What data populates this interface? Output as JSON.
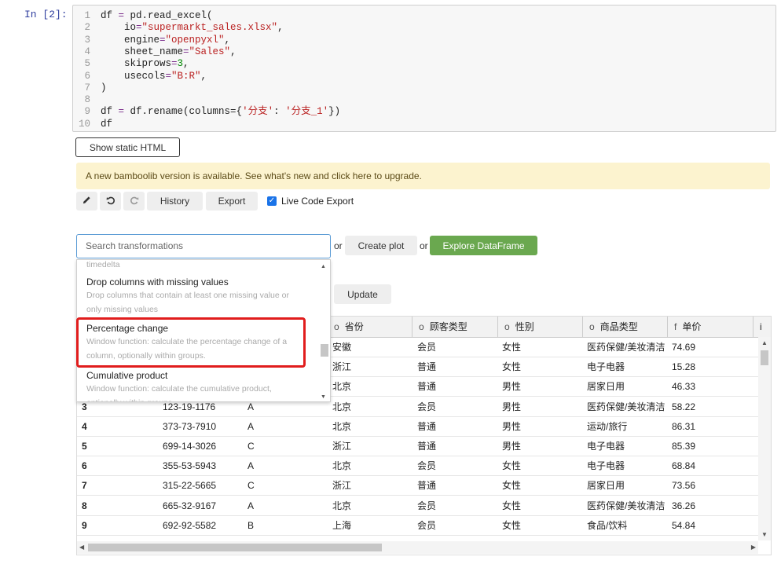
{
  "prompt": "In  [2]:",
  "code": {
    "lines": [
      {
        "n": "1",
        "parts": [
          {
            "t": "df ",
            "c": ""
          },
          {
            "t": "=",
            "c": "c-op"
          },
          {
            "t": " pd.read_excel(",
            "c": ""
          }
        ]
      },
      {
        "n": "2",
        "parts": [
          {
            "t": "    io",
            "c": ""
          },
          {
            "t": "=",
            "c": "c-op"
          },
          {
            "t": "\"supermarkt_sales.xlsx\"",
            "c": "c-str"
          },
          {
            "t": ",",
            "c": ""
          }
        ]
      },
      {
        "n": "3",
        "parts": [
          {
            "t": "    engine",
            "c": ""
          },
          {
            "t": "=",
            "c": "c-op"
          },
          {
            "t": "\"openpyxl\"",
            "c": "c-str"
          },
          {
            "t": ",",
            "c": ""
          }
        ]
      },
      {
        "n": "4",
        "parts": [
          {
            "t": "    sheet_name",
            "c": ""
          },
          {
            "t": "=",
            "c": "c-op"
          },
          {
            "t": "\"Sales\"",
            "c": "c-str"
          },
          {
            "t": ",",
            "c": ""
          }
        ]
      },
      {
        "n": "5",
        "parts": [
          {
            "t": "    skiprows",
            "c": ""
          },
          {
            "t": "=",
            "c": "c-op"
          },
          {
            "t": "3",
            "c": "c-num"
          },
          {
            "t": ",",
            "c": ""
          }
        ]
      },
      {
        "n": "6",
        "parts": [
          {
            "t": "    usecols",
            "c": ""
          },
          {
            "t": "=",
            "c": "c-op"
          },
          {
            "t": "\"B:R\"",
            "c": "c-str"
          },
          {
            "t": ",",
            "c": ""
          }
        ]
      },
      {
        "n": "7",
        "parts": [
          {
            "t": ")",
            "c": ""
          }
        ]
      },
      {
        "n": "8",
        "parts": [
          {
            "t": "",
            "c": ""
          }
        ]
      },
      {
        "n": "9",
        "parts": [
          {
            "t": "df ",
            "c": ""
          },
          {
            "t": "=",
            "c": "c-op"
          },
          {
            "t": " df.rename(columns={",
            "c": ""
          },
          {
            "t": "'分支'",
            "c": "c-str"
          },
          {
            "t": ": ",
            "c": ""
          },
          {
            "t": "'分支_1'",
            "c": "c-str"
          },
          {
            "t": "})",
            "c": ""
          }
        ]
      },
      {
        "n": "10",
        "parts": [
          {
            "t": "df",
            "c": ""
          }
        ]
      }
    ]
  },
  "buttons": {
    "show_static_html": "Show static HTML",
    "history": "History",
    "export": "Export",
    "create_plot": "Create plot",
    "explore_dataframe": "Explore DataFrame",
    "update": "Update",
    "or": "or"
  },
  "banner": "A new bamboolib version is available. See what's new and click here to upgrade.",
  "live_code_export": {
    "label": "Live Code Export",
    "checked": true
  },
  "search": {
    "placeholder": "Search transformations"
  },
  "dropdown": {
    "partial_top": "timedelta",
    "items": [
      {
        "title": "Drop columns with missing values",
        "desc1": "Drop columns that contain at least one missing value or",
        "desc2": "only missing values"
      },
      {
        "title": "Percentage change",
        "desc1": "Window function: calculate the percentage change of a",
        "desc2": "column, optionally within groups."
      },
      {
        "title": "Cumulative product",
        "desc1": "Window function: calculate the cumulative product,",
        "desc2": "optionally within groups."
      }
    ]
  },
  "table": {
    "columns": [
      {
        "dtype": "o",
        "name": "省份"
      },
      {
        "dtype": "o",
        "name": "顾客类型"
      },
      {
        "dtype": "o",
        "name": "性别"
      },
      {
        "dtype": "o",
        "name": "商品类型"
      },
      {
        "dtype": "f",
        "name": "单价"
      },
      {
        "dtype": "",
        "name": "i"
      }
    ],
    "rows": [
      {
        "idx": "",
        "id": "",
        "b": "",
        "prov": "安徽",
        "type": "会员",
        "gender": "女性",
        "cat": "医药保健/美妆清洁",
        "price": "74.69"
      },
      {
        "idx": "",
        "id": "",
        "b": "",
        "prov": "浙江",
        "type": "普通",
        "gender": "女性",
        "cat": "电子电器",
        "price": "15.28"
      },
      {
        "idx": "",
        "id": "",
        "b": "",
        "prov": "北京",
        "type": "普通",
        "gender": "男性",
        "cat": "居家日用",
        "price": "46.33"
      },
      {
        "idx": "3",
        "id": "123-19-1176",
        "b": "A",
        "prov": "北京",
        "type": "会员",
        "gender": "男性",
        "cat": "医药保健/美妆清洁",
        "price": "58.22"
      },
      {
        "idx": "4",
        "id": "373-73-7910",
        "b": "A",
        "prov": "北京",
        "type": "普通",
        "gender": "男性",
        "cat": "运动/旅行",
        "price": "86.31"
      },
      {
        "idx": "5",
        "id": "699-14-3026",
        "b": "C",
        "prov": "浙江",
        "type": "普通",
        "gender": "男性",
        "cat": "电子电器",
        "price": "85.39"
      },
      {
        "idx": "6",
        "id": "355-53-5943",
        "b": "A",
        "prov": "北京",
        "type": "会员",
        "gender": "女性",
        "cat": "电子电器",
        "price": "68.84"
      },
      {
        "idx": "7",
        "id": "315-22-5665",
        "b": "C",
        "prov": "浙江",
        "type": "普通",
        "gender": "女性",
        "cat": "居家日用",
        "price": "73.56"
      },
      {
        "idx": "8",
        "id": "665-32-9167",
        "b": "A",
        "prov": "北京",
        "type": "会员",
        "gender": "女性",
        "cat": "医药保健/美妆清洁",
        "price": "36.26"
      },
      {
        "idx": "9",
        "id": "692-92-5582",
        "b": "B",
        "prov": "上海",
        "type": "会员",
        "gender": "女性",
        "cat": "食品/饮料",
        "price": "54.84"
      }
    ]
  },
  "colors": {
    "accent_green": "#6aa84f",
    "highlight_red": "#e11d1d",
    "banner_bg": "#fcf3cf",
    "checkbox_blue": "#1a73e8"
  }
}
